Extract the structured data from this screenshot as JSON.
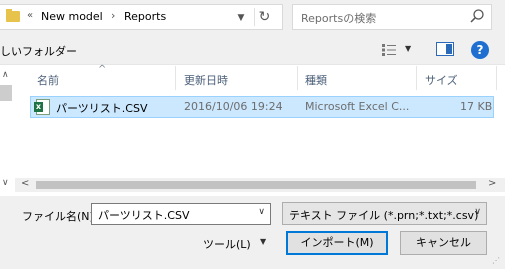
{
  "address": {
    "prefix": "«",
    "crumbs": [
      "New model",
      "Reports"
    ],
    "separator": "›"
  },
  "search": {
    "placeholder": "Reportsの検索"
  },
  "toolbar": {
    "new_folder": "しいフォルダー"
  },
  "columns": [
    "名前",
    "更新日時",
    "種類",
    "サイズ"
  ],
  "files": [
    {
      "name": "パーツリスト.CSV",
      "modified": "2016/10/06 19:24",
      "type": "Microsoft Excel C...",
      "size": "17 KB"
    }
  ],
  "filename": {
    "label": "ファイル名(N):",
    "value": "パーツリスト.CSV"
  },
  "filetype": {
    "value": "テキスト ファイル (*.prn;*.txt;*.csv)"
  },
  "buttons": {
    "tools": "ツール(L)",
    "import": "インポート(M)",
    "cancel": "キャンセル"
  },
  "colors": {
    "selection": "#cce8ff",
    "accent": "#0078d7",
    "help": "#1f6fd1",
    "excel": "#1f7244"
  }
}
